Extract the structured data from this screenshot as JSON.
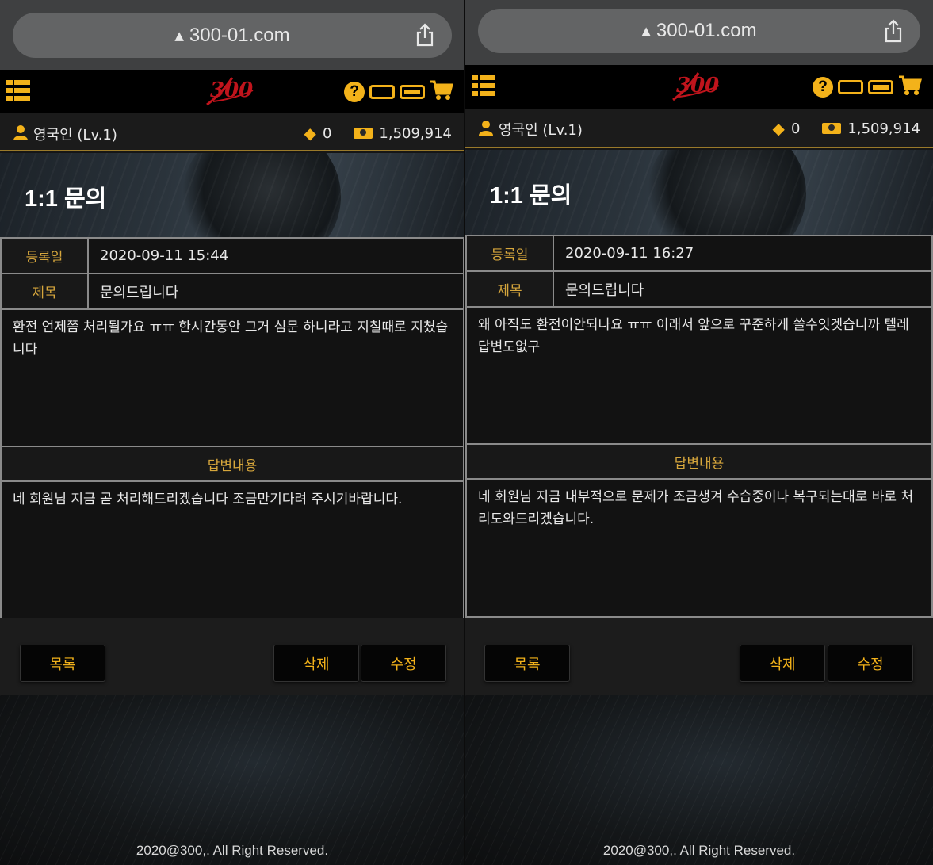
{
  "panels": [
    {
      "browser": {
        "url": "300-01.com"
      },
      "user": {
        "name": "영국인 (Lv.1)",
        "gems": "0",
        "cash": "1,509,914"
      },
      "page_title": "1:1 문의",
      "detail": {
        "date_label": "등록일",
        "date_value": "2020-09-11 15:44",
        "subject_label": "제목",
        "subject_value": "문의드립니다",
        "content": "환전 언제쯤 처리될가요 ㅠㅠ 한시간동안 그거 심문 하니라고 지칠때로 지쳤습니다",
        "answer_label": "답변내용",
        "answer": "네 회원님 지금 곧 처리해드리겠습니다 조금만기다려 주시기바랍니다."
      },
      "buttons": {
        "list": "목록",
        "delete": "삭제",
        "edit": "수정"
      },
      "footer": "2020@300,. All Right Reserved."
    },
    {
      "browser": {
        "url": "300-01.com"
      },
      "user": {
        "name": "영국인 (Lv.1)",
        "gems": "0",
        "cash": "1,509,914"
      },
      "page_title": "1:1 문의",
      "detail": {
        "date_label": "등록일",
        "date_value": "2020-09-11 16:27",
        "subject_label": "제목",
        "subject_value": "문의드립니다",
        "content": "왜 아직도 환전이안되나요 ㅠㅠ 이래서 앞으로 꾸준하게 쓸수잇겟습니까 텔레 답변도없구",
        "answer_label": "답변내용",
        "answer": "네 회원님 지금 내부적으로 문제가 조금생겨 수습중이나 복구되는대로 바로 처리도와드리겠습니다."
      },
      "buttons": {
        "list": "목록",
        "delete": "삭제",
        "edit": "수정"
      },
      "footer": "2020@300,. All Right Reserved."
    }
  ],
  "colors": {
    "accent": "#f3b21a",
    "label": "#d6a63c",
    "border": "#8a8a8a",
    "logo": "#c0141c"
  },
  "icons": [
    "warning-icon",
    "share-icon",
    "menu-icon",
    "help-icon",
    "card-icon",
    "cart-icon",
    "user-icon",
    "gem-icon",
    "cash-icon"
  ]
}
